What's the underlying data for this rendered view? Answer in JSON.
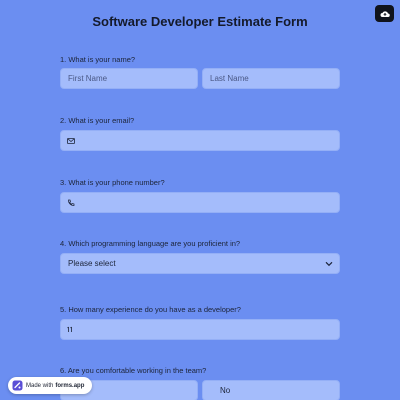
{
  "form": {
    "title": "Software Developer Estimate Form"
  },
  "questions": [
    {
      "label": "1.  What is your name?"
    },
    {
      "label": "2. What is your email?"
    },
    {
      "label": "3. What is your phone number?"
    },
    {
      "label": "4. Which programming language are you proficient in?"
    },
    {
      "label": "5. How many experience do you have as a developer?"
    },
    {
      "label": "6. Are you comfortable working in the team?"
    }
  ],
  "fields": {
    "first_name_placeholder": "First Name",
    "last_name_placeholder": "Last Name",
    "language_select_value": "Please select",
    "team_option_no": "No"
  },
  "icons": {
    "email": "envelope-icon",
    "phone": "phone-icon",
    "experience": "number-icon",
    "select": "chevron-down-icon",
    "corner": "cloud-upload-icon"
  },
  "badge": {
    "prefix": "Made with",
    "brand": "forms.app"
  },
  "colors": {
    "background": "#6b8ef1",
    "field": "#a4bcfb",
    "text": "#1a2236"
  }
}
